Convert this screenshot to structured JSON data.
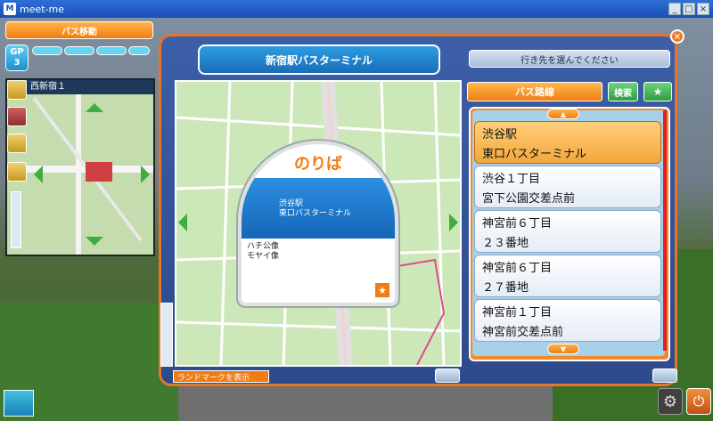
{
  "window": {
    "title": "meet-me",
    "app_icon": "M"
  },
  "hud": {
    "move_bus_label": "バス移動",
    "gp_label": "GP",
    "gp_value": "3",
    "area_name": "西新宿１"
  },
  "dialog": {
    "title": "新宿駅バスターミナル",
    "instruction": "行き先を選んでください",
    "close_label": "×",
    "tabs": {
      "route": "バス路線",
      "search": "検索",
      "favorite": "★"
    },
    "landmark_button": "ランドマークを表示",
    "stop_card": {
      "title": "のりば",
      "selected_line1": "渋谷駅",
      "selected_line2": "東口バスターミナル",
      "other_line1": "ハチ公像",
      "other_line2": "モヤイ像",
      "star": "★"
    },
    "destinations": [
      {
        "line1": "渋谷駅",
        "line2": "東口バスターミナル",
        "selected": true
      },
      {
        "line1": "渋谷１丁目",
        "line2": "宮下公園交差点前",
        "selected": false
      },
      {
        "line1": "神宮前６丁目",
        "line2": "２３番地",
        "selected": false
      },
      {
        "line1": "神宮前６丁目",
        "line2": "２７番地",
        "selected": false
      },
      {
        "line1": "神宮前１丁目",
        "line2": "神宮前交差点前",
        "selected": false
      }
    ]
  },
  "colors": {
    "accent_orange": "#f07d12",
    "dialog_blue": "#2d4a8c",
    "map_green": "#c9e6b3",
    "selected_blue": "#1466b8"
  }
}
